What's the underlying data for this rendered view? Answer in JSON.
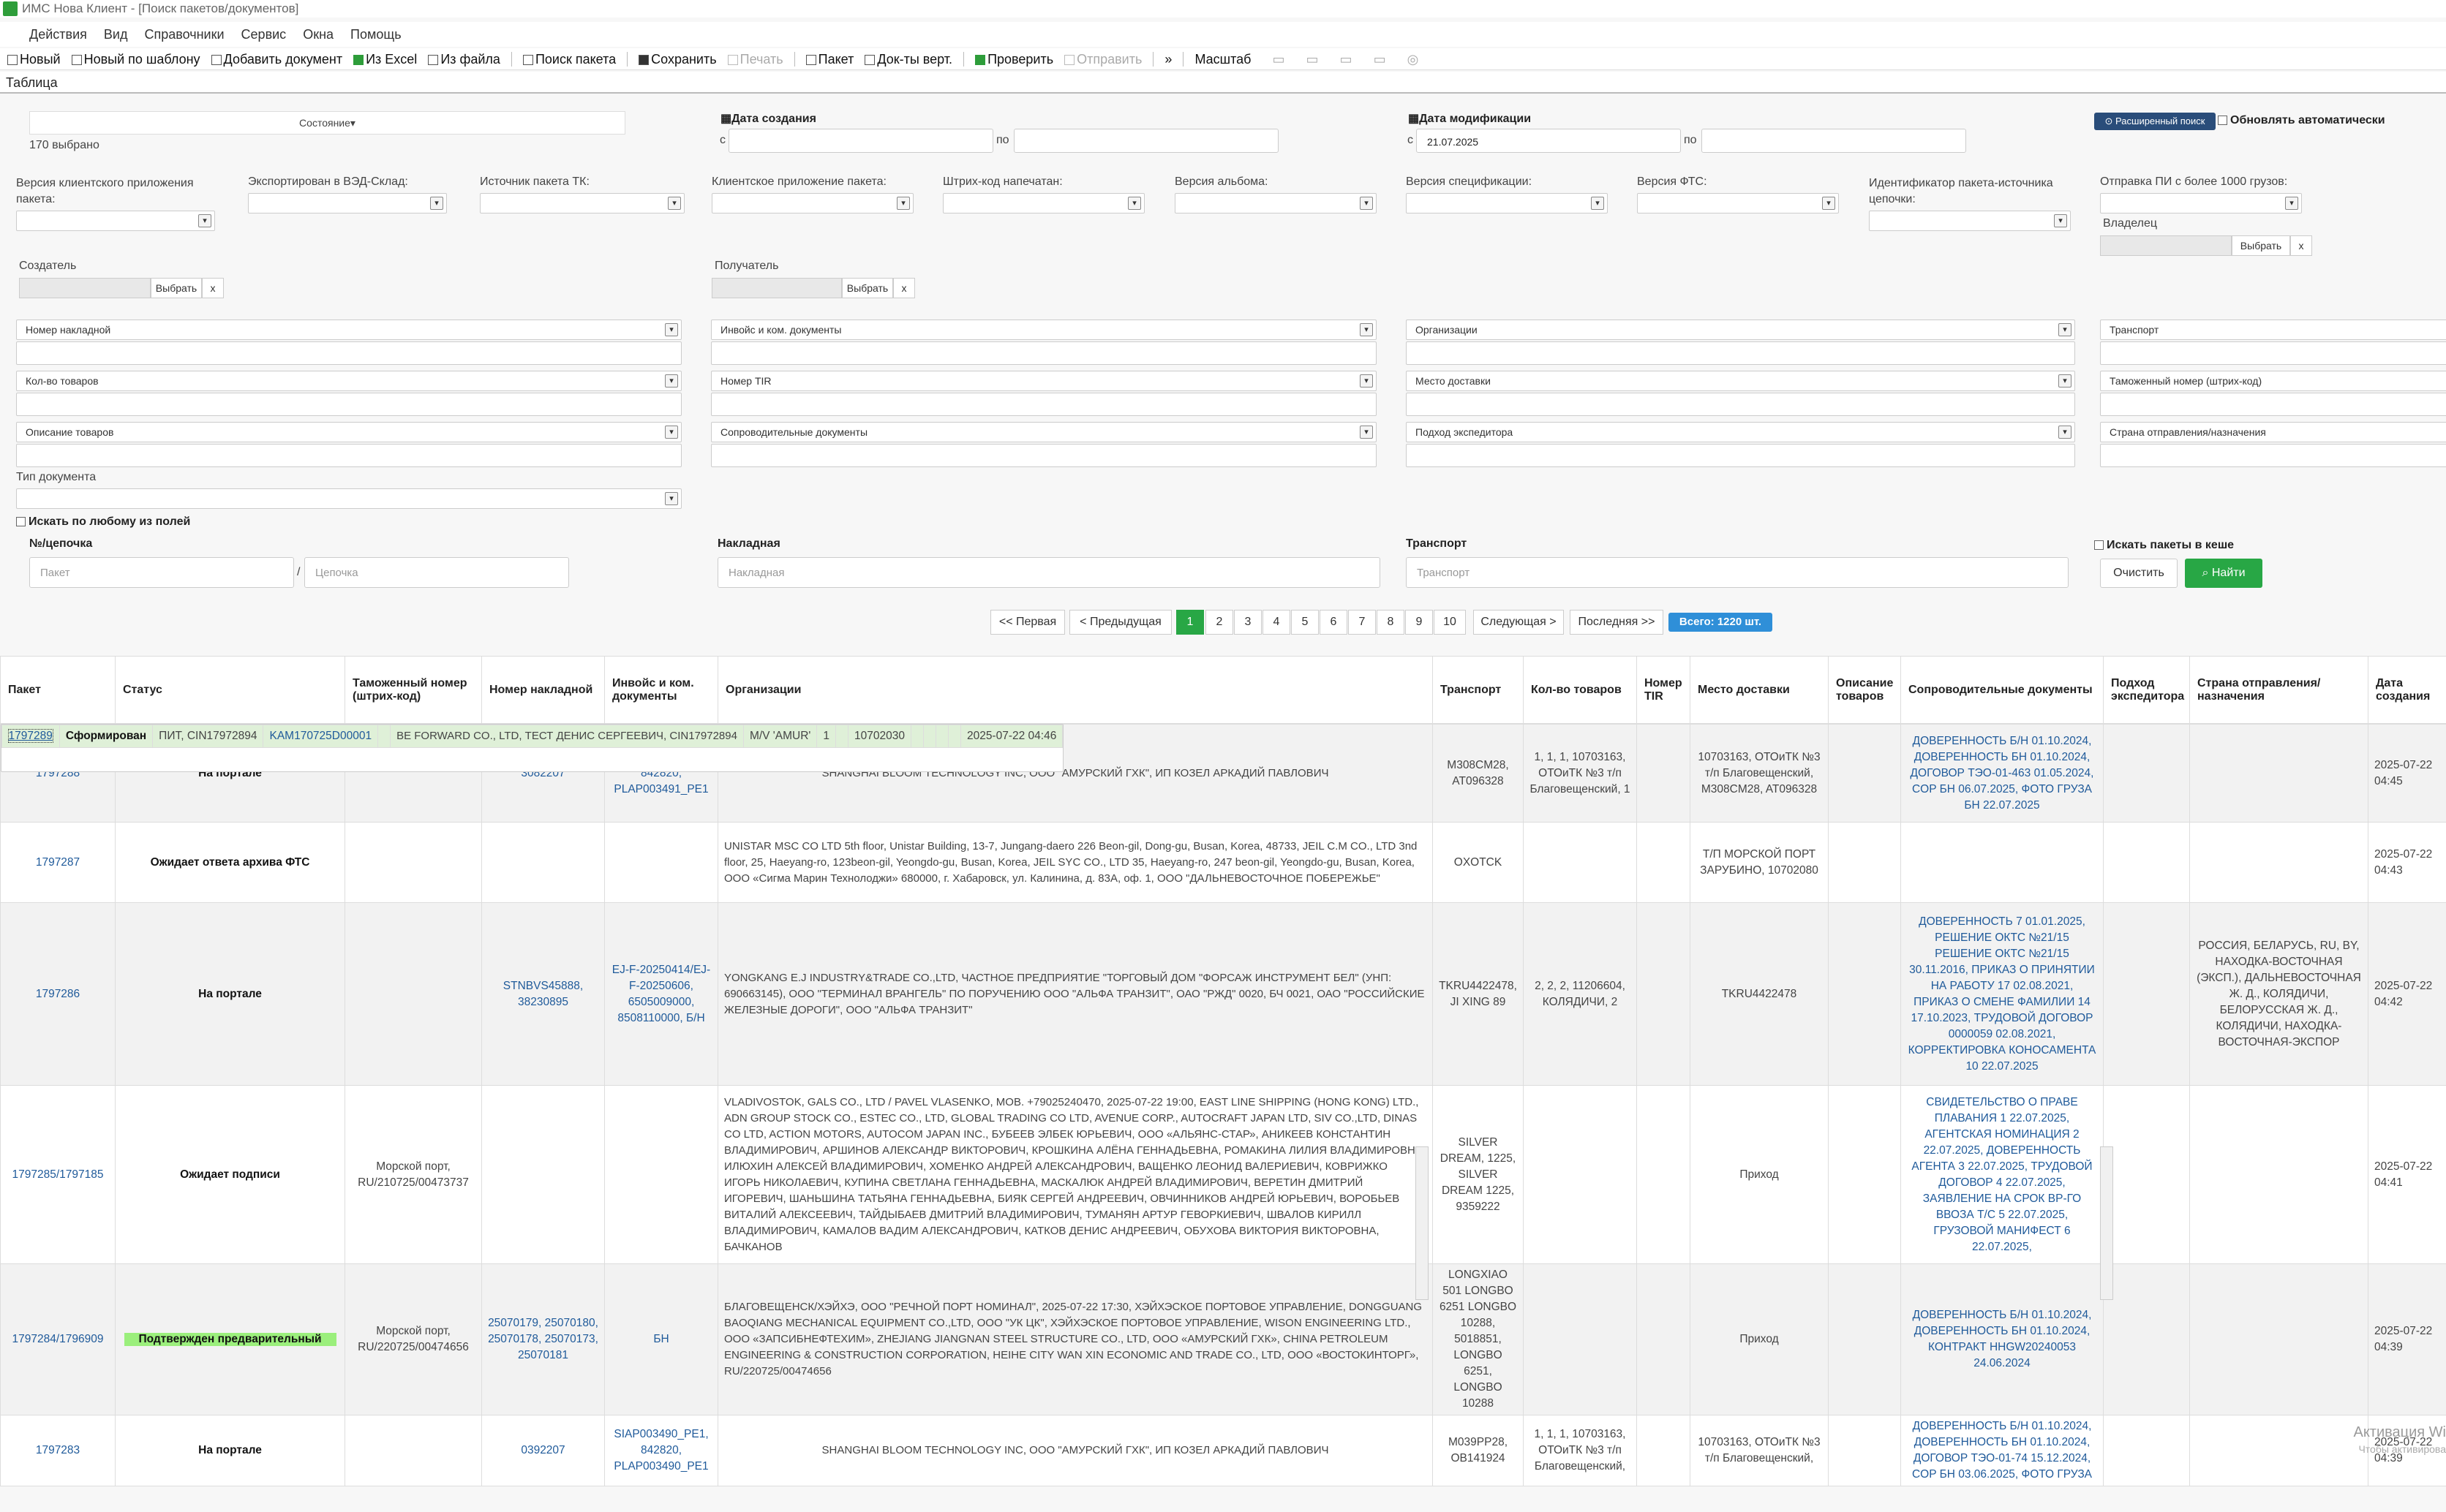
{
  "window": {
    "title": "ИМС Нова Клиент - [Поиск пакетов/документов]"
  },
  "menu": [
    "Действия",
    "Вид",
    "Справочники",
    "Сервис",
    "Окна",
    "Помощь"
  ],
  "toolbar": {
    "new": "Новый",
    "new_template": "Новый по шаблону",
    "add_doc": "Добавить документ",
    "from_excel": "Из Excel",
    "from_file": "Из файла",
    "search_packet": "Поиск пакета",
    "save": "Сохранить",
    "print": "Печать",
    "packet": "Пакет",
    "docs_vert": "Док-ты верт.",
    "check": "Проверить",
    "send": "Отправить",
    "more": "»",
    "scale": "Масштаб"
  },
  "tab": "Таблица",
  "form": {
    "state": "Состояние",
    "selected": "170 выбрано",
    "date_created": "Дата создания",
    "date_modified": "Дата модификации",
    "from": "с",
    "to": "по",
    "date_modified_from": "21.07.2025",
    "advanced_btn": "Расширенный поиск",
    "auto_refresh": "Обновлять автоматически",
    "f_client_version": "Версия клиентского приложения пакета:",
    "f_exported": "Экспортирован в ВЭД-Склад:",
    "f_source": "Источник пакета ТК:",
    "f_client_app": "Клиентское приложение пакета:",
    "f_barcode": "Штрих-код напечатан:",
    "f_album": "Версия альбома:",
    "f_spec": "Версия спецификации:",
    "f_fts": "Версия ФТС:",
    "f_chain": "Идентификатор пакета-источника цепочки:",
    "f_pi": "Отправка ПИ с более 1000 грузов:",
    "owner": "Владелец",
    "creator": "Создатель",
    "receiver": "Получатель",
    "choose": "Выбрать",
    "x": "x",
    "s_waybill": "Номер накладной",
    "s_invoice": "Инвойс и ком. документы",
    "s_orgs": "Организации",
    "s_transport": "Транспорт",
    "s_goods_count": "Кол-во товаров",
    "s_tir": "Номер TIR",
    "s_delivery": "Место доставки",
    "s_customs_no": "Таможенный номер (штрих-код)",
    "s_goods_desc": "Описание товаров",
    "s_accomp": "Сопроводительные документы",
    "s_forwarder": "Подход экспедитора",
    "s_country": "Страна отправления/назначения",
    "doc_type": "Тип документа",
    "search_any": "Искать по любому из полей",
    "chain_lbl": "№/цепочка",
    "ph_packet": "Пакет",
    "slash": "/",
    "ph_chain": "Цепочка",
    "waybill_lbl": "Накладная",
    "ph_waybill": "Накладная",
    "transport_lbl": "Транспорт",
    "ph_transport": "Транспорт",
    "cache": "Искать пакеты в кеше",
    "clear": "Очистить",
    "find": "Найти"
  },
  "pager": {
    "first": "<< Первая",
    "prev": "< Предыдущая",
    "pages": [
      "1",
      "2",
      "3",
      "4",
      "5",
      "6",
      "7",
      "8",
      "9",
      "10"
    ],
    "next": "Следующая >",
    "last": "Последняя >>",
    "total": "Всего: 1220 шт."
  },
  "columns": [
    "Пакет",
    "Статус",
    "Таможенный номер (штрих-код)",
    "Номер накладной",
    "Инвойс и ком. документы",
    "Организации",
    "Транспорт",
    "Кол-во товаров",
    "Номер TIR",
    "Место доставки",
    "Описание товаров",
    "Сопроводительные документы",
    "Подход экспедитора",
    "Страна отправления/назначения",
    "Дата создания"
  ],
  "rows": [
    {
      "packet": "1797289",
      "status": "Сформирован",
      "customs": "ПИТ, CIN17972894",
      "waybill": "KAM170725D00001",
      "invoice": "",
      "orgs": "BE FORWARD CO., LTD, ТЕСТ ДЕНИС СЕРГЕЕВИЧ, CIN17972894",
      "transport": "M/V 'AMUR'",
      "goods": "1",
      "tir": "",
      "delivery": "10702030",
      "desc": "",
      "docs": "",
      "forwarder": "",
      "country": "",
      "date": "2025-07-22 04:46"
    },
    {
      "packet": "1797288",
      "status": "На портале",
      "customs": "",
      "waybill": "3082207",
      "invoice": "SIAP003491_PE1, 842820, PLAP003491_PE1",
      "orgs": "SHANGHAI BLOOM TECHNOLOGY INC, ООО \"АМУРСКИЙ ГХК\", ИП КОЗЕЛ АРКАДИЙ ПАВЛОВИЧ",
      "transport": "M308CM28, AT096328",
      "goods": "1, 1, 1, 10703163, ОТОиТК №3 т/п Благовещенский, 1",
      "tir": "",
      "delivery": "10703163, ОТОиТК №3 т/п Благовещенский, M308CM28, AT096328",
      "desc": "",
      "docs": "ДОВЕРЕННОСТЬ Б/Н 01.10.2024, ДОВЕРЕННОСТЬ БН 01.10.2024, ДОГОВОР ТЭО-01-463 01.05.2024, COP БН 06.07.2025, ФОТО ГРУЗА БН 22.07.2025",
      "forwarder": "",
      "country": "",
      "date": "2025-07-22 04:45"
    },
    {
      "packet": "1797287",
      "status": "Ожидает ответа архива ФТС",
      "customs": "",
      "waybill": "",
      "invoice": "",
      "orgs": "UNISTAR MSC CO LTD 5th floor, Unistar Building, 13-7, Jungang-daero 226 Beon-gil, Dong-gu, Busan, Korea, 48733, JEIL C.M CO., LTD 3nd floor, 25, Haeyang-ro, 123beon-gil, Yeongdo-gu, Busan, Korea, JEIL SYC CO., LTD 35, Haeyang-ro, 247 beon-gil, Yeongdo-gu, Busan, Korea, ООО «Сигма Марин Технолоджи» 680000, г. Хабаровск, ул. Калинина, д. 83А, оф. 1, ООО \"ДАЛЬНЕВОСТОЧНОЕ ПОБЕРЕЖЬЕ\"",
      "transport": "OXOTCK",
      "goods": "",
      "tir": "",
      "delivery": "Т/П МОРСКОЙ ПОРТ ЗАРУБИНО, 10702080",
      "desc": "",
      "docs": "",
      "forwarder": "",
      "country": "",
      "date": "2025-07-22 04:43"
    },
    {
      "packet": "1797286",
      "status": "На портале",
      "customs": "",
      "waybill": "STNBVS45888, 38230895",
      "invoice": "EJ-F-20250414/EJ-F-20250606, 6505009000, 8508110000, Б/Н",
      "orgs": "YONGKANG E.J INDUSTRY&TRADE CO.,LTD, ЧАСТНОЕ ПРЕДПРИЯТИЕ \"ТОРГОВЫЙ ДОМ \"ФОРСАЖ ИНСТРУМЕНТ БЕЛ\" (УНП: 690663145), ООО \"ТЕРМИНАЛ ВРАНГЕЛЬ\" ПО ПОРУЧЕНИЮ ООО \"АЛЬФА ТРАНЗИТ\", ОАО \"РЖД\" 0020, БЧ 0021, ОАО \"РОССИЙСКИЕ ЖЕЛЕЗНЫЕ ДОРОГИ\", ООО \"АЛЬФА ТРАНЗИТ\"",
      "transport": "TKRU4422478, JI XING 89",
      "goods": "2, 2, 2, 11206604, КОЛЯДИЧИ, 2",
      "tir": "",
      "delivery": "TKRU4422478",
      "desc": "",
      "docs": "ДОВЕРЕННОСТЬ 7 01.01.2025, РЕШЕНИЕ ОКТС №21/15 РЕШЕНИЕ ОКТС №21/15 30.11.2016, ПРИКАЗ О ПРИНЯТИИ НА РАБОТУ 17 02.08.2021, ПРИКАЗ О СМЕНЕ ФАМИЛИИ 14 17.10.2023, ТРУДОВОЙ ДОГОВОР 0000059 02.08.2021, КОРРЕКТИРОВКА КОНОСАМЕНТА 10 22.07.2025",
      "forwarder": "",
      "country": "РОССИЯ, БЕЛАРУСЬ, RU, BY, НАХОДКА-ВОСТОЧНАЯ (ЭКСП.), ДАЛЬНЕВОСТОЧНАЯ Ж. Д., КОЛЯДИЧИ, БЕЛОРУССКАЯ Ж. Д., КОЛЯДИЧИ, НАХОДКА-ВОСТОЧНАЯ-ЭКСПОР",
      "date": "2025-07-22 04:42"
    },
    {
      "packet": "1797285/1797185",
      "status": "Ожидает подписи",
      "customs": "Морской порт, RU/210725/00473737",
      "waybill": "",
      "invoice": "",
      "orgs": "VLADIVOSTOK, GALS CO., LTD / PAVEL VLASENKO, MOB. +79025240470, 2025-07-22 19:00, EAST LINE SHIPPING (HONG KONG) LTD., ADN GROUP STOCK CO., ESTEC CO., LTD, GLOBAL TRADING CO LTD, AVENUE CORP., AUTOCRAFT JAPAN LTD, SIV CO.,LTD, DINAS CO LTD, ACTION MOTORS, AUTOCOM JAPAN INC., БУБЕЕВ ЭЛБЕК ЮРЬЕВИЧ, ООО «АЛЬЯНС-СТАР», АНИКЕЕВ КОНСТАНТИН ВЛАДИМИРОВИЧ, АРШИНОВ АЛЕКСАНДР ВИКТОРОВИЧ, КРОШКИНА АЛЁНА ГЕННАДЬЕВНА, РОМАКИНА ЛИЛИЯ ВЛАДИМИРОВНА, ИЛЮХИН АЛЕКСЕЙ ВЛАДИМИРОВИЧ, ХОМЕНКО АНДРЕЙ АЛЕКСАНДРОВИЧ, ВАЩЕНКО ЛЕОНИД ВАЛЕРИЕВИЧ, КОВРИЖКО ИГОРЬ НИКОЛАЕВИЧ, КУПИНА СВЕТЛАНА ГЕННАДЬЕВНА, МАСКАЛЮК АНДРЕЙ ВЛАДИМИРОВИЧ, ВЕРЕТИН ДМИТРИЙ ИГОРЕВИЧ, ШАНЬШИНА ТАТЬЯНА ГЕННАДЬЕВНА, БИЯК СЕРГЕЙ АНДРЕЕВИЧ, ОВЧИННИКОВ АНДРЕЙ ЮРЬЕВИЧ, ВОРОБЬЕВ ВИТАЛИЙ АЛЕКСЕЕВИЧ, ТАЙДЫБАЕВ ДМИТРИЙ ВЛАДИМИРОВИЧ, ТУМАНЯН АРТУР ГЕВОРКИЕВИЧ, ШВАЛОВ КИРИЛЛ ВЛАДИМИРОВИЧ, КАМАЛОВ ВАДИМ АЛЕКСАНДРОВИЧ, КАТКОВ ДЕНИС АНДРЕЕВИЧ, ОБУХОВА ВИКТОРИЯ ВИКТОРОВНА, БАЧКАНОВ",
      "transport": "SILVER DREAM, 1225, SILVER DREAM 1225, 9359222",
      "goods": "",
      "tir": "",
      "delivery": "Приход",
      "desc": "",
      "docs": "СВИДЕТЕЛЬСТВО О ПРАВЕ ПЛАВАНИЯ 1 22.07.2025, АГЕНТСКАЯ НОМИНАЦИЯ 2 22.07.2025, ДОВЕРЕННОСТЬ АГЕНТА 3 22.07.2025, ТРУДОВОЙ ДОГОВОР 4 22.07.2025, ЗАЯВЛЕНИЕ НА СРОК ВР-ГО ВВОЗА Т/С 5 22.07.2025, ГРУЗОВОЙ МАНИФЕСТ 6 22.07.2025,",
      "forwarder": "",
      "country": "",
      "date": "2025-07-22 04:41"
    },
    {
      "packet": "1797284/1796909",
      "status": "Подтвержден предварительный",
      "customs": "Морской порт, RU/220725/00474656",
      "waybill": "25070179, 25070180, 25070178, 25070173, 25070181",
      "invoice": "БН",
      "orgs": "БЛАГОВЕЩЕНСК/ХЭЙХЭ, ООО \"РЕЧНОЙ ПОРТ НОМИНАЛ\", 2025-07-22 17:30, ХЭЙХЭСКОЕ ПОРТОВОЕ УПРАВЛЕНИЕ, DONGGUANG BAOQIANG MECHANICAL EQUIPMENT CO.,LTD, ООО \"УК ЦК\", ХЭЙХЭСКОЕ ПОРТОВОЕ УПРАВЛЕНИЕ, WISON ENGINEERING LTD., ООО «ЗАПСИБНЕФТЕХИМ», ZHEJIANG JIANGNAN STEEL STRUCTURE CO., LTD, ООО «АМУРСКИЙ ГХК», CHINA PETROLEUM ENGINEERING & CONSTRUCTION CORPORATION, HEIHE CITY WAN XIN ECONOMIC AND TRADE CO., LTD, ООО «ВОСТОКИНТОРГ», RU/220725/00474656",
      "transport": "LONGXIAO 501 LONGBO 6251 LONGBO 10288, 5018851, LONGBO 6251, LONGBO 10288",
      "goods": "",
      "tir": "",
      "delivery": "Приход",
      "desc": "",
      "docs": "ДОВЕРЕННОСТЬ Б/Н 01.10.2024, ДОВЕРЕННОСТЬ БН 01.10.2024, КОНТРАКТ HHGW20240053 24.06.2024",
      "forwarder": "",
      "country": "",
      "date": "2025-07-22 04:39"
    },
    {
      "packet": "1797283",
      "status": "На портале",
      "customs": "",
      "waybill": "0392207",
      "invoice": "SIAP003490_PE1, 842820, PLAP003490_PE1",
      "orgs": "SHANGHAI BLOOM TECHNOLOGY INC, ООО \"АМУРСКИЙ ГХК\", ИП КОЗЕЛ АРКАДИЙ ПАВЛОВИЧ",
      "transport": "M039PP28, OB141924",
      "goods": "1, 1, 1, 10703163, ОТОиТК №3 т/п Благовещенский,",
      "tir": "",
      "delivery": "10703163, ОТОиТК №3 т/п Благовещенский,",
      "desc": "",
      "docs": "ДОВЕРЕННОСТЬ Б/Н 01.10.2024, ДОВЕРЕННОСТЬ БН 01.10.2024, ДОГОВОР ТЭО-01-74 15.12.2024, COP БН 03.06.2025, ФОТО ГРУЗА",
      "forwarder": "",
      "country": "",
      "date": "2025-07-22 04:39"
    }
  ],
  "watermark": {
    "line1": "Активация Wi",
    "line2": "Чтобы активирова"
  },
  "colors": {
    "accent_green": "#28a745",
    "selected_row": "#dff0d8",
    "status_green": "#9bef7c",
    "link": "#1f5a9a",
    "advanced_btn": "#2a4d7a",
    "total_badge": "#2f8fd8"
  }
}
